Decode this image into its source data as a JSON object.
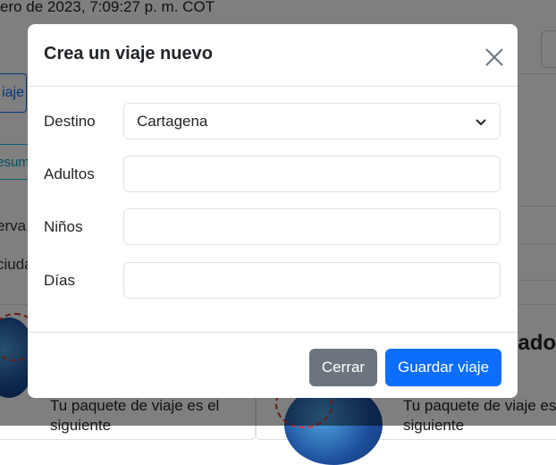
{
  "background": {
    "header_text": "ero de 2023, 7:09:27 p. m. COT",
    "tab_label": "iaje",
    "tab2_label": "esum",
    "side_text_1": "erva",
    "side_text_2": "ciuda",
    "card_text_left": "Tu paquete de viaje es el",
    "card_text_left_2": "siguiente",
    "card_text_right": "Tu paquete de viaje es el",
    "card_text_right_2": "siguiente",
    "right_title": "vado"
  },
  "modal": {
    "title": "Crea un viaje nuevo",
    "fields": {
      "destino": {
        "label": "Destino",
        "value": "Cartagena"
      },
      "adultos": {
        "label": "Adultos",
        "value": ""
      },
      "ninos": {
        "label": "Niños",
        "value": ""
      },
      "dias": {
        "label": "Días",
        "value": ""
      }
    },
    "buttons": {
      "close": "Cerrar",
      "save": "Guardar viaje"
    }
  },
  "colors": {
    "primary": "#0d6efd",
    "secondary": "#6c757d",
    "backdrop": "rgba(0,0,0,0.5)"
  }
}
